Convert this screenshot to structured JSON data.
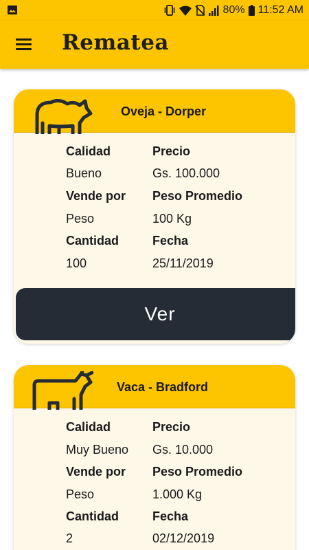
{
  "status_bar": {
    "battery": "80%",
    "time": "11:52 AM"
  },
  "app_bar": {
    "title": "Rematea",
    "menu_icon": "hamburger-menu-icon"
  },
  "listings": [
    {
      "title": "Oveja - Dorper",
      "icon": "sheep-icon",
      "calidad_label": "Calidad",
      "calidad": "Bueno",
      "precio_label": "Precio",
      "precio": "Gs. 100.000",
      "vende_por_label": "Vende por",
      "vende_por": "Peso",
      "peso_label": "Peso Promedio",
      "peso": "100 Kg",
      "cantidad_label": "Cantidad",
      "cantidad": "100",
      "fecha_label": "Fecha",
      "fecha": "25/11/2019",
      "button_label": "Ver"
    },
    {
      "title": "Vaca - Bradford",
      "icon": "cow-icon",
      "calidad_label": "Calidad",
      "calidad": "Muy Bueno",
      "precio_label": "Precio",
      "precio": "Gs. 10.000",
      "vende_por_label": "Vende por",
      "vende_por": "Peso",
      "peso_label": "Peso Promedio",
      "peso": "1.000 Kg",
      "cantidad_label": "Cantidad",
      "cantidad": "2",
      "fecha_label": "Fecha",
      "fecha": "02/12/2019"
    }
  ],
  "colors": {
    "accent": "#fdc500",
    "card_background": "#fef8e9",
    "button": "#262c35"
  }
}
